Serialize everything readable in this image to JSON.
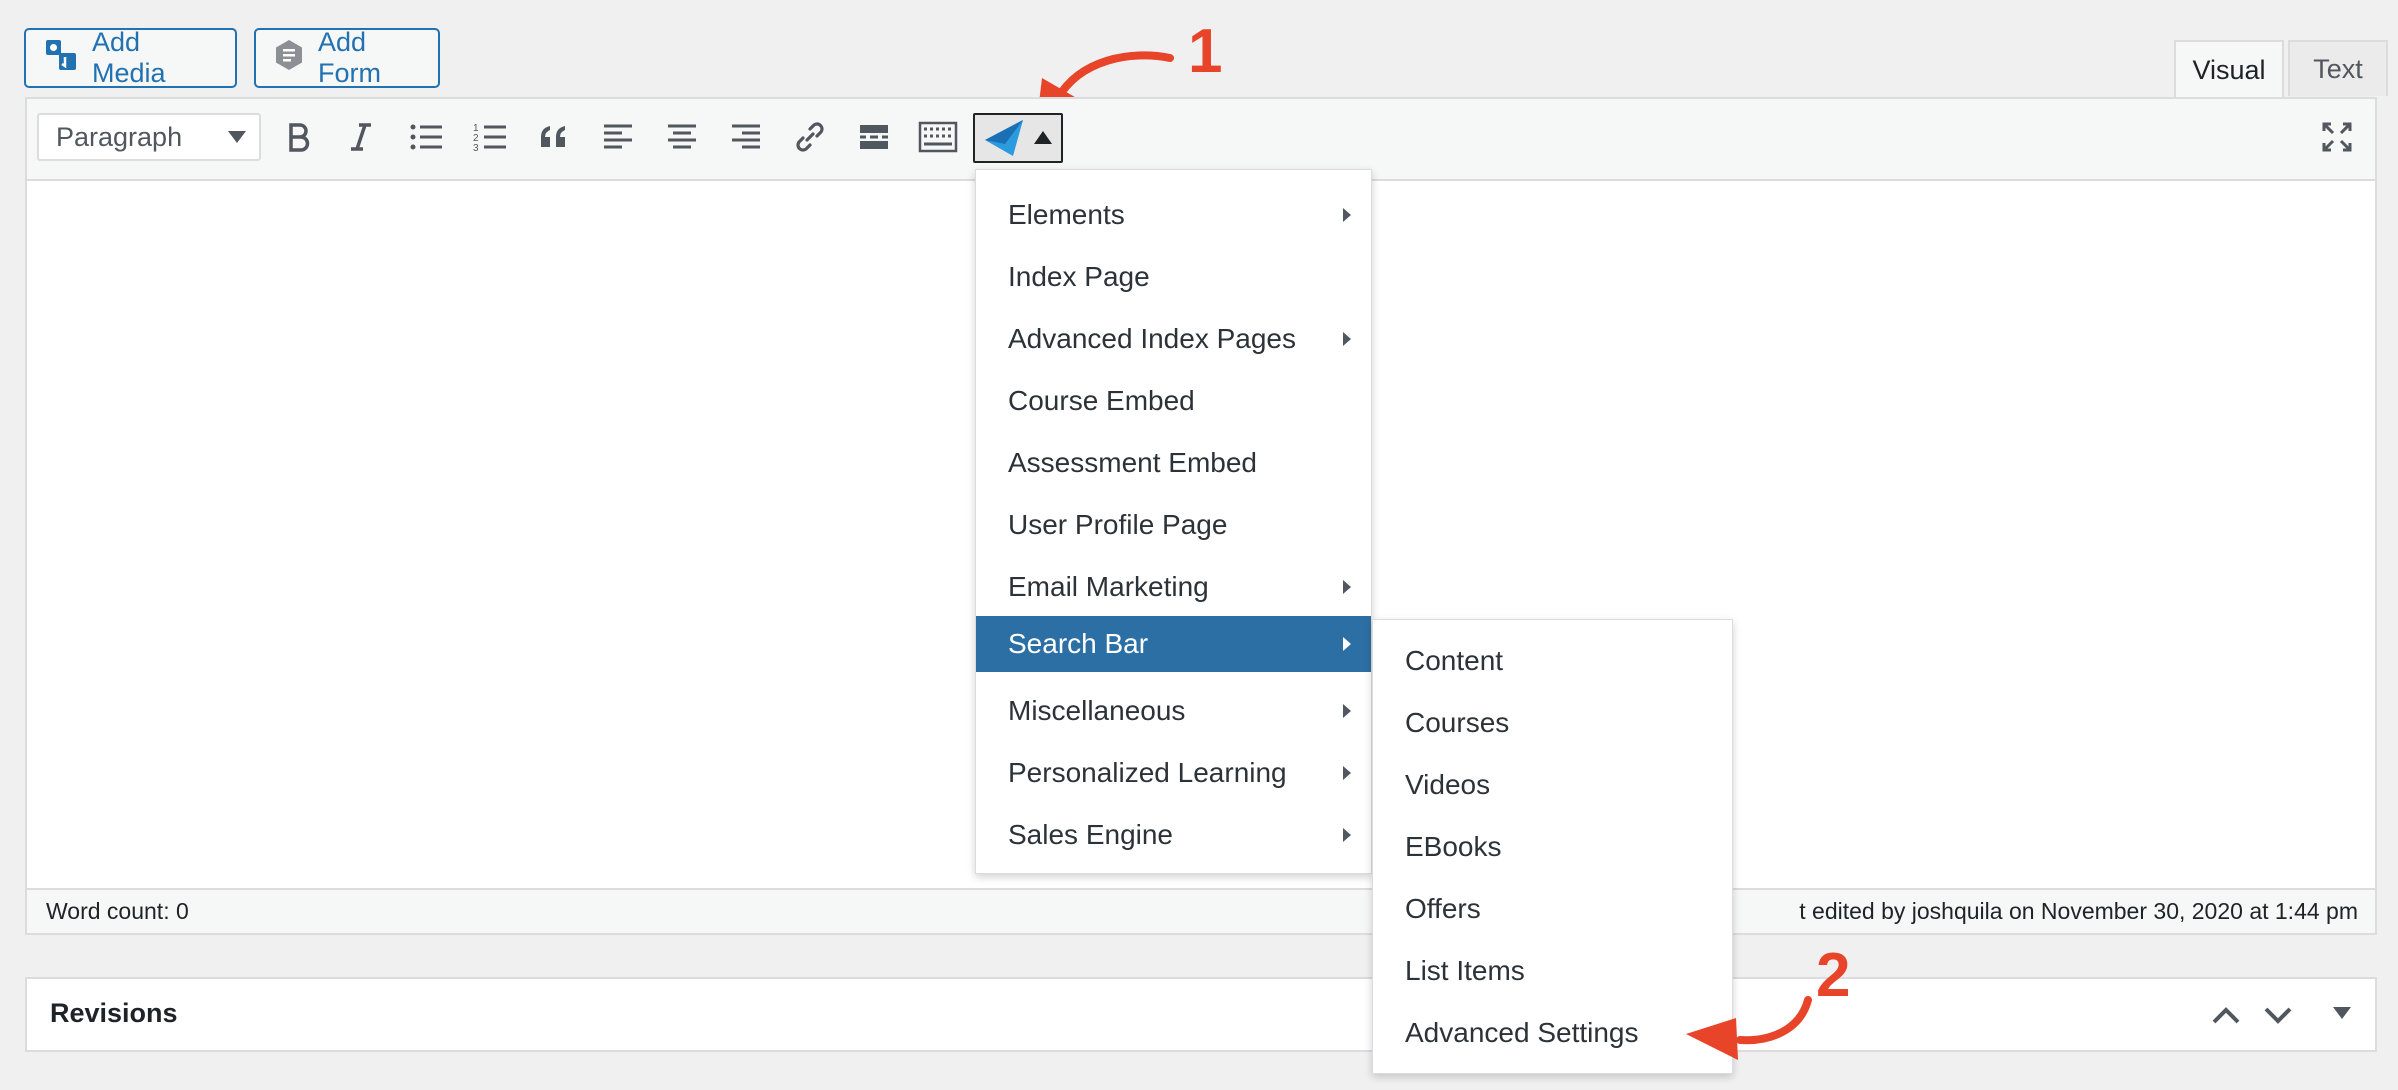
{
  "top_buttons": {
    "add_media": "Add Media",
    "add_form": "Add Form"
  },
  "tabs": {
    "visual": "Visual",
    "text": "Text"
  },
  "toolbar": {
    "format_value": "Paragraph",
    "icons": [
      "bold-icon",
      "italic-icon",
      "bulleted-list-icon",
      "numbered-list-icon",
      "blockquote-icon",
      "align-left-icon",
      "align-center-icon",
      "align-right-icon",
      "link-icon",
      "read-more-icon",
      "toolbar-toggle-icon",
      "plugin-paper-plane-icon",
      "fullscreen-icon"
    ]
  },
  "menu": {
    "items": [
      {
        "label": "Elements",
        "submenu": true
      },
      {
        "label": "Index Page",
        "submenu": false
      },
      {
        "label": "Advanced Index Pages",
        "submenu": true
      },
      {
        "label": "Course Embed",
        "submenu": false
      },
      {
        "label": "Assessment Embed",
        "submenu": false
      },
      {
        "label": "User Profile Page",
        "submenu": false
      },
      {
        "label": "Email Marketing",
        "submenu": true
      },
      {
        "label": "Search Bar",
        "submenu": true,
        "highlighted": true
      },
      {
        "label": "Miscellaneous",
        "submenu": true
      },
      {
        "label": "Personalized Learning",
        "submenu": true
      },
      {
        "label": "Sales Engine",
        "submenu": true
      }
    ]
  },
  "submenu": {
    "items": [
      "Content",
      "Courses",
      "Videos",
      "EBooks",
      "Offers",
      "List Items",
      "Advanced Settings"
    ]
  },
  "status": {
    "word_count": "Word count: 0",
    "last_edited": "t edited by joshquila on November 30, 2020 at 1:44 pm"
  },
  "revisions": {
    "title": "Revisions"
  },
  "annotations": {
    "one": "1",
    "two": "2"
  },
  "colors": {
    "accent": "#2271b1",
    "highlight": "#2c6fa5",
    "annotation": "#e8442a"
  }
}
